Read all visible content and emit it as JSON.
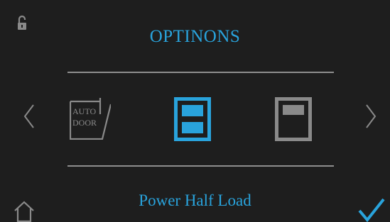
{
  "colors": {
    "background": "#1e1e1e",
    "accent": "#29a3dc",
    "inactive": "#8a8a8a",
    "divider": "#8e8e8e"
  },
  "header": {
    "title": "OPTINONS"
  },
  "options": {
    "auto_door_line1": "AUTO",
    "auto_door_line2": "DOOR",
    "selected": "Power Half Load"
  },
  "status": {
    "label": "Power Half Load"
  },
  "icons": {
    "lock": "unlock-icon",
    "prev": "chevron-left-icon",
    "next": "chevron-right-icon",
    "home": "home-icon",
    "confirm": "checkmark-icon"
  }
}
